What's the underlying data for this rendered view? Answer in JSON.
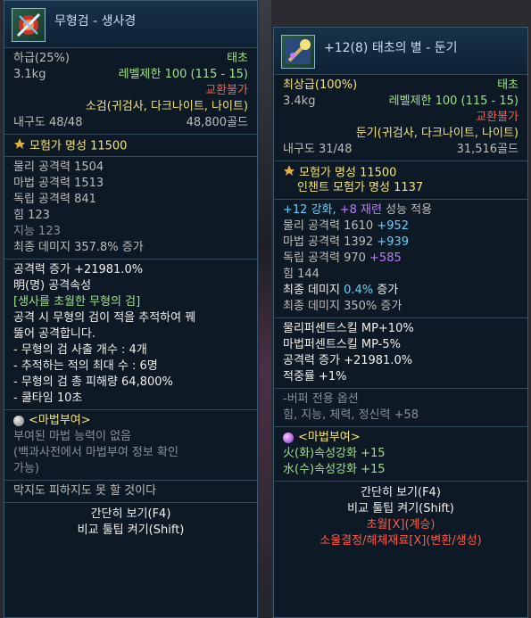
{
  "left": {
    "title": "무형검 - 생사경",
    "grade": "하급(25%)",
    "class_tag": "태초",
    "weight": "3.1kg",
    "level_limit": "레벨제한 100 (115 - 15)",
    "trade": "교환불가",
    "type": "소검(귀검사, 다크나이트, 나이트)",
    "durability": "내구도 48/48",
    "price": "48,800골드",
    "fame": "모험가 명성 11500",
    "stats": [
      "물리 공격력 1504",
      "마법 공격력 1513",
      "독립 공격력 841",
      "힘 123",
      "지능 123",
      "최종 데미지 357.8% 증가"
    ],
    "atk_up": "공격력 증가 +21981.0%",
    "element": "明(명) 공격속성",
    "flavor_title": "[생사를 초월한 무형의 검]",
    "flavor_lines": [
      "공격 시 무형의 검이 적을 추적하여 꿰",
      "뚫어 공격합니다.",
      "- 무형의 검 사출 개수 : 4개",
      "- 추적하는 적의 최대 수 : 6명",
      "- 무형의 검 총 피해량 64,800%",
      "- 쿨타임 10초"
    ],
    "enchant_title": "<마법부여>",
    "enchant_lines": [
      "부여된 마법 능력이 없음",
      "(백과사전에서 마법부여 정보 확인",
      "가능)"
    ],
    "quote": "막지도 피하지도 못 할 것이다",
    "btn_brief": "간단히 보기(F4)",
    "btn_compare": "비교 툴팁 켜기(Shift)"
  },
  "right": {
    "title": "+12(8) 태초의 별 - 둔기",
    "grade": "최상급(100%)",
    "class_tag": "태초",
    "weight": "3.4kg",
    "level_limit": "레벨제한 100 (115 - 15)",
    "trade": "교환불가",
    "type": "둔기(귀검사, 다크나이트, 나이트)",
    "durability": "내구도 31/48",
    "price": "31,516골드",
    "fame": "모험가 명성 11500",
    "enchant_fame": "인챈트 모험가 명성 1137",
    "reinforce": {
      "a": "+12 강화,",
      "b": "+8 재련",
      "c": "성능 적용"
    },
    "stats": [
      {
        "label": "물리 공격력 1610",
        "bonus": "+952",
        "color": "cyan"
      },
      {
        "label": "마법 공격력 1392",
        "bonus": "+939",
        "color": "cyan"
      },
      {
        "label": "독립 공격력 970",
        "bonus": "+585",
        "color": "purple"
      }
    ],
    "str": "힘 144",
    "final1": {
      "a": "최종 데미지",
      "b": "0.4%",
      "c": "증가"
    },
    "final2": "최종 데미지 350% 증가",
    "skills": [
      "물리퍼센트스킬 MP+10%",
      "마법퍼센트스킬 MP-5%",
      "공격력 증가 +21981.0%",
      "적중률 +1%"
    ],
    "buffer_title": "-버퍼 전용 옵션",
    "buffer_line": "힘, 지능, 체력, 정신력 +58",
    "enchant_title": "<마법부여>",
    "enchant_lines": [
      "火(화)속성강화 +15",
      "水(수)속성강화 +15"
    ],
    "btn_brief": "간단히 보기(F4)",
    "btn_compare": "비교 툴팁 켜기(Shift)",
    "transcend": "초월[X](계승)",
    "extract": "소울결정/해체재료[X](변환/생성)"
  },
  "colors": {
    "accent": "#9fe08a",
    "trade": "#ff5a4a",
    "fame": "#f4e27a",
    "reinforce": "#5fd3ff",
    "purple": "#c277ff"
  }
}
